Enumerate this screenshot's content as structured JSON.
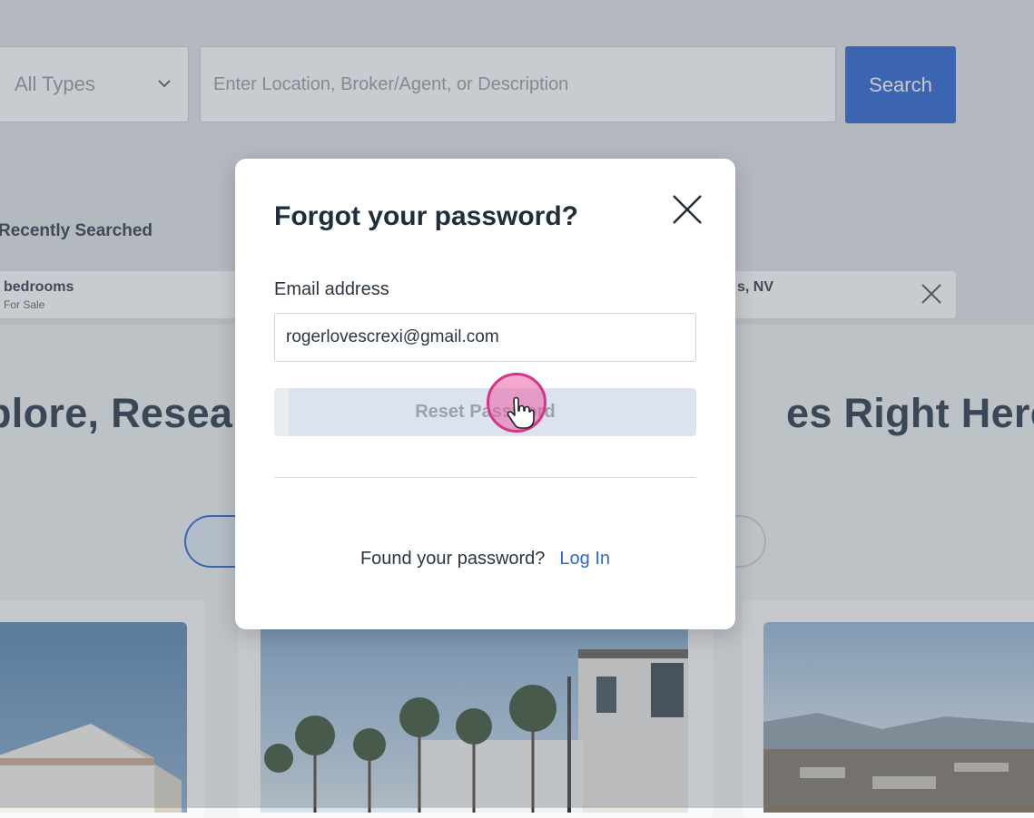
{
  "search": {
    "type_value": "All Types",
    "placeholder": "Enter Location, Broker/Agent, or Description",
    "button": "Search"
  },
  "recent": {
    "title": "Recently Searched",
    "items": [
      {
        "main": "bedrooms",
        "sub": "For Sale"
      },
      {
        "main": "s, NV"
      }
    ]
  },
  "hero": {
    "left_text": "plore, Resear",
    "right_text": "es Right Here!"
  },
  "modal": {
    "title": "Forgot your password?",
    "email_label": "Email address",
    "email_value": "rogerlovescrexi@gmail.com",
    "reset_button": "Reset Password",
    "found_text": "Found your password?",
    "login_link": "Log In"
  },
  "colors": {
    "brand_blue": "#1d5bcf",
    "link_blue": "#2a6bd6",
    "cursor_highlight": "#d6338a"
  }
}
